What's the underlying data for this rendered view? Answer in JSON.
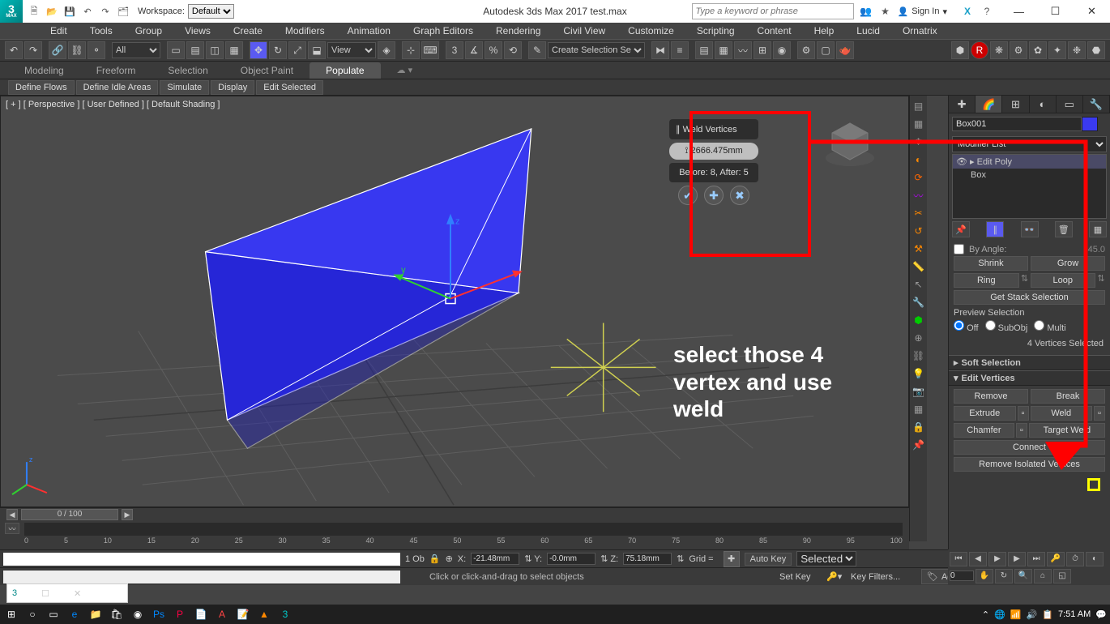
{
  "app": {
    "title": "Autodesk 3ds Max 2017    test.max",
    "workspace_label": "Workspace:",
    "workspace_value": "Default",
    "search_placeholder": "Type a keyword or phrase",
    "signin_label": "Sign In"
  },
  "menu": {
    "items": [
      "Edit",
      "Tools",
      "Group",
      "Views",
      "Create",
      "Modifiers",
      "Animation",
      "Graph Editors",
      "Rendering",
      "Civil View",
      "Customize",
      "Scripting",
      "Content",
      "Help",
      "Lucid",
      "Ornatrix"
    ]
  },
  "main_toolbar": {
    "filter": "All",
    "view": "View",
    "selset": "Create Selection Se"
  },
  "ribbon": {
    "tabs": [
      "Modeling",
      "Freeform",
      "Selection",
      "Object Paint",
      "Populate"
    ],
    "active": 4,
    "sub": [
      "Define Flows",
      "Define Idle Areas",
      "Simulate",
      "Display",
      "Edit Selected"
    ]
  },
  "viewport": {
    "label": "[ + ] [ Perspective ] [ User Defined ] [ Default Shading ]"
  },
  "caddy": {
    "title": "Weld Vertices",
    "value": "2666.475mm",
    "status": "Before: 8, After: 5"
  },
  "annotation": {
    "text": "select those 4 vertex and use weld"
  },
  "cmd": {
    "obj_name": "Box001",
    "modifier_list": "Modifier List",
    "stack_items": [
      "Edit Poly",
      "Box"
    ],
    "by_angle_label": "By Angle:",
    "by_angle_value": "45.0",
    "shrink": "Shrink",
    "grow": "Grow",
    "ring": "Ring",
    "loop": "Loop",
    "get_stack": "Get Stack Selection",
    "preview_label": "Preview Selection",
    "preview_off": "Off",
    "preview_sub": "SubObj",
    "preview_multi": "Multi",
    "sel_status": "4 Vertices Selected",
    "soft_sel": "Soft Selection",
    "edit_verts": "Edit Vertices",
    "remove": "Remove",
    "break": "Break",
    "extrude": "Extrude",
    "weld": "Weld",
    "chamfer": "Chamfer",
    "target_weld": "Target Weld",
    "connect": "Connect",
    "remove_iso": "Remove Isolated Vertices"
  },
  "timeline": {
    "frame_label": "0 / 100",
    "ticks": [
      "0",
      "5",
      "10",
      "15",
      "20",
      "25",
      "30",
      "35",
      "40",
      "45",
      "50",
      "55",
      "60",
      "65",
      "70",
      "75",
      "80",
      "85",
      "90",
      "95",
      "100"
    ]
  },
  "status": {
    "obj_count": "1 Ob",
    "x": "-21.48mm",
    "y": "-0.0mm",
    "z": "75.18mm",
    "grid": "Grid =",
    "autokey": "Auto Key",
    "selected": "Selected",
    "setkey": "Set Key",
    "keyfilters": "Key Filters...",
    "spinner": "0",
    "prompt": "Click or click-and-drag to select objects",
    "timetag": "Add Time Tag"
  },
  "taskbar": {
    "time": "7:51 AM"
  }
}
